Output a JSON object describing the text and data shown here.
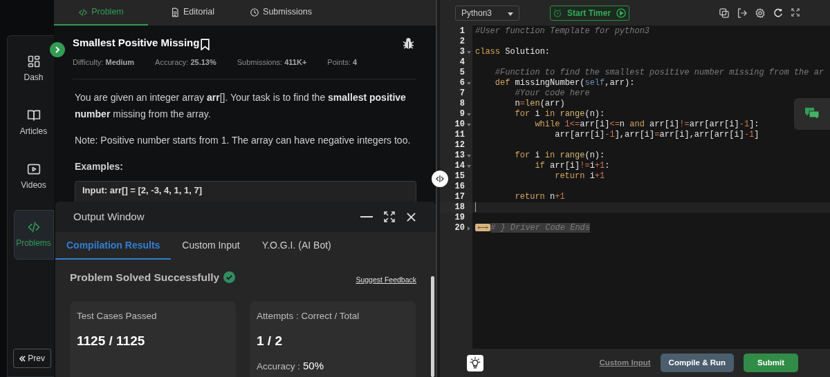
{
  "sidebar": {
    "items": [
      {
        "label": "Dash",
        "selected": false
      },
      {
        "label": "Articles",
        "selected": false
      },
      {
        "label": "Videos",
        "selected": false
      },
      {
        "label": "Problems",
        "selected": true
      }
    ],
    "prev_button": "Prev"
  },
  "problem_tabs": [
    {
      "label": "Problem",
      "selected": true
    },
    {
      "label": "Editorial",
      "selected": false
    },
    {
      "label": "Submissions",
      "selected": false
    }
  ],
  "problem": {
    "title": "Smallest Positive Missing",
    "meta": [
      "Difficulty: **Medium**",
      "Accuracy: **25.13%**",
      "Submissions: **411K+**",
      "Points: **4**"
    ],
    "paragraphs": [
      "You are given an integer array **arr**[]. Your task is to find the **smallest positive number** missing from the array.",
      "Note: Positive number starts from 1. The array can have negative integers too."
    ],
    "examples_heading": "Examples:",
    "example_input": "Input: arr[] = [2, -3, 4, 1, 1, 7]"
  },
  "output_window": {
    "title": "Output Window",
    "tabs": [
      {
        "label": "Compilation Results",
        "selected": true
      },
      {
        "label": "Custom Input",
        "selected": false
      },
      {
        "label": "Y.O.G.I. (AI Bot)",
        "selected": false
      }
    ],
    "status": "Problem Solved Successfully",
    "feedback_link": "Suggest Feedback",
    "cards": [
      {
        "label": "Test Cases Passed",
        "value": "1125 / 1125"
      },
      {
        "label": "Attempts : Correct / Total",
        "value": "1 / 2",
        "sub_label": "Accuracy :",
        "sub_value": "50%"
      }
    ]
  },
  "editor": {
    "language": "Python3",
    "timer_button": "Start Timer",
    "lines": [
      {
        "number": "1",
        "tokens": [
          {
            "text": "#User function Template for python3",
            "kind": "comment"
          }
        ]
      },
      {
        "number": "2"
      },
      {
        "number": "3",
        "folded": false,
        "tokens": [
          {
            "text": "class",
            "kind": "keyword"
          },
          {
            "text": " Solution:",
            "kind": "plain"
          }
        ]
      },
      {
        "number": "4"
      },
      {
        "number": "5",
        "tokens": [
          {
            "text": "    #Function to find the smallest positive number missing from the ar",
            "kind": "comment"
          }
        ]
      },
      {
        "number": "6",
        "folded": false,
        "tokens": [
          {
            "text": "    def",
            "kind": "keyword"
          },
          {
            "text": " missingNumber(",
            "kind": "plain"
          },
          {
            "text": "self",
            "kind": "self"
          },
          {
            "text": ",arr):",
            "kind": "plain"
          }
        ]
      },
      {
        "number": "7",
        "tokens": [
          {
            "text": "        #Your code here",
            "kind": "comment"
          }
        ]
      },
      {
        "number": "8",
        "tokens": [
          {
            "text": "        n",
            "kind": "plain"
          },
          {
            "text": "=",
            "kind": "operator"
          },
          {
            "text": "len",
            "kind": "builtin"
          },
          {
            "text": "(arr)",
            "kind": "plain"
          }
        ]
      },
      {
        "number": "9",
        "folded": false,
        "tokens": [
          {
            "text": "        for",
            "kind": "keyword"
          },
          {
            "text": " i ",
            "kind": "plain"
          },
          {
            "text": "in",
            "kind": "keyword"
          },
          {
            "text": " range",
            "kind": "builtin"
          },
          {
            "text": "(n):",
            "kind": "plain"
          }
        ]
      },
      {
        "number": "10",
        "folded": false,
        "tokens": [
          {
            "text": "            while",
            "kind": "keyword"
          },
          {
            "text": " 1",
            "kind": "number"
          },
          {
            "text": "<=",
            "kind": "operator"
          },
          {
            "text": "arr[i]",
            "kind": "plain"
          },
          {
            "text": "<=",
            "kind": "operator"
          },
          {
            "text": "n ",
            "kind": "plain"
          },
          {
            "text": "and",
            "kind": "keyword"
          },
          {
            "text": " arr[i]",
            "kind": "plain"
          },
          {
            "text": "!=",
            "kind": "operator"
          },
          {
            "text": "arr[arr[i]",
            "kind": "plain"
          },
          {
            "text": "-",
            "kind": "operator"
          },
          {
            "text": "1",
            "kind": "number"
          },
          {
            "text": "]:",
            "kind": "plain"
          }
        ]
      },
      {
        "number": "11",
        "tokens": [
          {
            "text": "                arr[arr[i]",
            "kind": "plain"
          },
          {
            "text": "-",
            "kind": "operator"
          },
          {
            "text": "1",
            "kind": "number"
          },
          {
            "text": "],arr[i]",
            "kind": "plain"
          },
          {
            "text": "=",
            "kind": "operator"
          },
          {
            "text": "arr[i],arr[arr[i]",
            "kind": "plain"
          },
          {
            "text": "-",
            "kind": "operator"
          },
          {
            "text": "1",
            "kind": "number"
          },
          {
            "text": "]",
            "kind": "plain"
          }
        ]
      },
      {
        "number": "12"
      },
      {
        "number": "13",
        "folded": false,
        "tokens": [
          {
            "text": "        for",
            "kind": "keyword"
          },
          {
            "text": " i ",
            "kind": "plain"
          },
          {
            "text": "in",
            "kind": "keyword"
          },
          {
            "text": " range",
            "kind": "builtin"
          },
          {
            "text": "(n):",
            "kind": "plain"
          }
        ]
      },
      {
        "number": "14",
        "folded": false,
        "tokens": [
          {
            "text": "            if",
            "kind": "keyword"
          },
          {
            "text": " arr[i]",
            "kind": "plain"
          },
          {
            "text": "!=",
            "kind": "operator"
          },
          {
            "text": "i",
            "kind": "plain"
          },
          {
            "text": "+",
            "kind": "operator"
          },
          {
            "text": "1",
            "kind": "number"
          },
          {
            "text": ":",
            "kind": "plain"
          }
        ]
      },
      {
        "number": "15",
        "tokens": [
          {
            "text": "                return",
            "kind": "keyword"
          },
          {
            "text": " i",
            "kind": "plain"
          },
          {
            "text": "+",
            "kind": "operator"
          },
          {
            "text": "1",
            "kind": "number"
          }
        ]
      },
      {
        "number": "16"
      },
      {
        "number": "17",
        "tokens": [
          {
            "text": "        return",
            "kind": "keyword"
          },
          {
            "text": " n",
            "kind": "plain"
          },
          {
            "text": "+",
            "kind": "operator"
          },
          {
            "text": "1",
            "kind": "number"
          }
        ]
      },
      {
        "number": "18",
        "current": true
      },
      {
        "number": "19"
      },
      {
        "number": "20",
        "folded": true,
        "tokens": [
          {
            "text": "# } Driver Code Ends",
            "kind": "comment"
          }
        ]
      }
    ],
    "custom_input_link": "Custom Input",
    "compile_button": "Compile & Run",
    "submit_button": "Submit"
  }
}
